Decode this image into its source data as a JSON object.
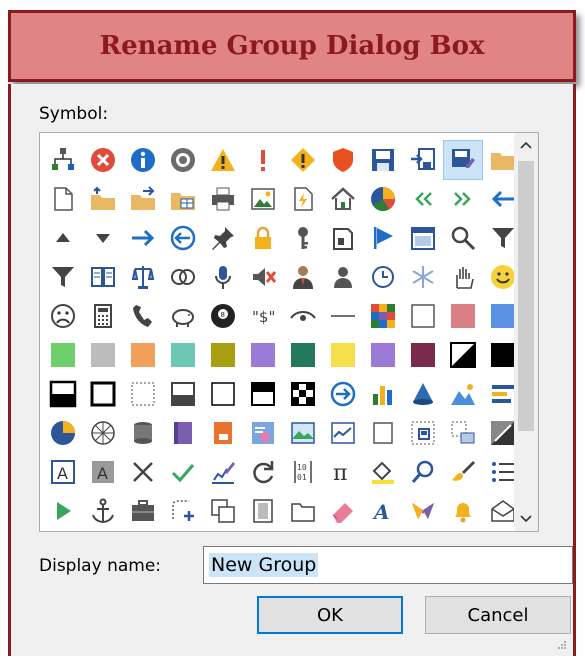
{
  "banner": {
    "title": "Rename Group Dialog Box"
  },
  "dialog": {
    "symbol_label": "Symbol:",
    "display_name_label": "Display name:",
    "display_name_value": "New Group",
    "ok_label": "OK",
    "cancel_label": "Cancel"
  },
  "symbols": [
    [
      "org-chart-icon",
      "error-icon",
      "info-icon",
      "record-icon",
      "warning-icon",
      "exclamation-icon",
      "diamond-warning-icon",
      "shield-icon",
      "save-icon",
      "import-icon",
      "save-as-icon",
      "folder-icon"
    ],
    [
      "document-icon",
      "folder-up-icon",
      "folder-move-icon",
      "folder-grid-icon",
      "printer-icon",
      "picture-icon",
      "document-flash-icon",
      "home-icon",
      "pie-chart-icon",
      "double-left-arrow-icon",
      "double-right-arrow-icon",
      "left-arrow-icon"
    ],
    [
      "triangle-up-icon",
      "triangle-down-icon",
      "right-arrow-icon",
      "back-circle-icon",
      "pin-icon",
      "lock-icon",
      "key-icon",
      "page-icon",
      "flag-icon",
      "calendar-icon",
      "magnifier-icon",
      "filter-icon"
    ],
    [
      "filter-icon",
      "book-icon",
      "scales-icon",
      "rings-icon",
      "microphone-icon",
      "mute-icon",
      "person-icon",
      "user-icon",
      "clock-icon",
      "snowflake-icon",
      "hand-icon",
      "smile-icon"
    ],
    [
      "frown-icon",
      "calculator-icon",
      "phone-icon",
      "piggy-bank-icon",
      "eight-ball-icon",
      "dollar-quote-icon",
      "eye-icon",
      "dash-icon",
      "color-grid-icon",
      "square-outline-icon",
      "swatch-rose-icon",
      "swatch-blue-icon"
    ],
    [
      "swatch-green-icon",
      "swatch-gray-icon",
      "swatch-orange-icon",
      "swatch-teal-icon",
      "swatch-olive-icon",
      "swatch-purple-icon",
      "swatch-darkgreen-icon",
      "swatch-yellow-icon",
      "swatch-violet-icon",
      "swatch-maroon-icon",
      "contrast-icon",
      "swatch-black-icon"
    ],
    [
      "border-bottom-icon",
      "border-outline-icon",
      "border-dotted-icon",
      "border-fill-bottom-icon",
      "border-thin-icon",
      "border-top-icon",
      "checker-icon",
      "circle-arrow-icon",
      "bar-chart-icon",
      "cone-icon",
      "mountain-chart-icon",
      "align-icon"
    ],
    [
      "pie-quarter-icon",
      "web-icon",
      "database-icon",
      "book-purple-icon",
      "book-orange-icon",
      "people-group-icon",
      "landscape-icon",
      "chart-box-icon",
      "frame-icon",
      "table-select-icon",
      "table-resize-icon",
      "diagonal-icon"
    ],
    [
      "text-a-icon",
      "text-a-gray-icon",
      "close-x-icon",
      "checkmark-icon",
      "edit-chart-icon",
      "refresh-icon",
      "binary-icon",
      "pi-icon",
      "paint-bucket-icon",
      "search-icon",
      "brush-icon",
      "list-icon"
    ],
    [
      "play-icon",
      "anchor-icon",
      "briefcase-icon",
      "shape-add-icon",
      "copy-icon",
      "page-column-icon",
      "folder-outline-icon",
      "eraser-icon",
      "italic-a-icon",
      "office-logo-icon",
      "bell-icon",
      "envelope-open-icon"
    ]
  ],
  "selected_symbol": "save-as-icon",
  "colors": {
    "banner_fill": "#e08486",
    "banner_border": "#8b1a1f",
    "selection": "#cce4f7",
    "ok_border": "#0078d7"
  }
}
